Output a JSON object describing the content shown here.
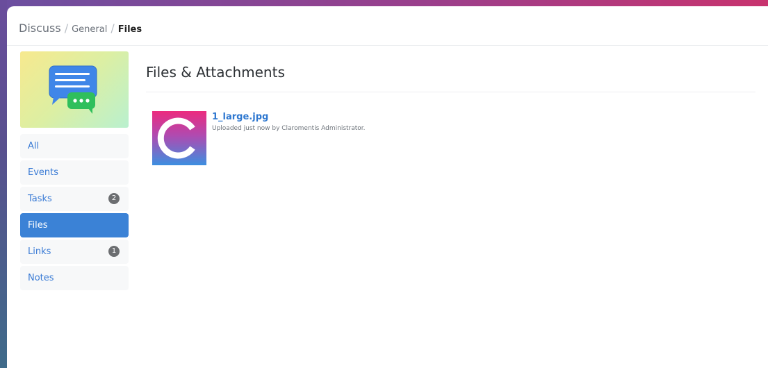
{
  "breadcrumb": {
    "root": "Discuss",
    "section": "General",
    "current": "Files"
  },
  "sidebar": {
    "hero_icon": "chat-bubbles-icon",
    "items": [
      {
        "label": "All"
      },
      {
        "label": "Events"
      },
      {
        "label": "Tasks",
        "badge": "2"
      },
      {
        "label": "Files",
        "active": true
      },
      {
        "label": "Links",
        "badge": "1"
      },
      {
        "label": "Notes"
      }
    ]
  },
  "main": {
    "title": "Files & Attachments",
    "files": [
      {
        "name": "1_large.jpg",
        "meta": "Uploaded just now by Claromentis Administrator.",
        "thumbnail_icon": "claromentis-logo-icon"
      }
    ]
  },
  "colors": {
    "accent": "#3b82d6",
    "link": "#2f78d0",
    "badge": "#6c6e71"
  }
}
